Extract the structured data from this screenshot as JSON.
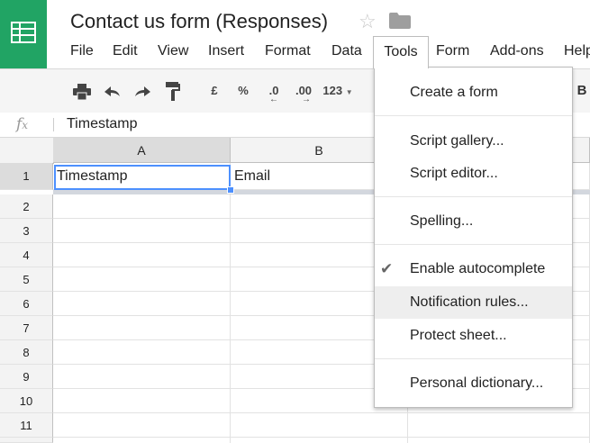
{
  "app": {
    "logo_icon": "sheets-logo-icon",
    "title": "Contact us form (Responses)"
  },
  "menubar": {
    "items": [
      "File",
      "Edit",
      "View",
      "Insert",
      "Format",
      "Data",
      "Tools",
      "Form",
      "Add-ons",
      "Help"
    ],
    "open_menu": "Tools"
  },
  "toolbar": {
    "currency": "£",
    "percent": "%",
    "decrease_decimals": ".0",
    "increase_decimals": ".00",
    "number_format": "123",
    "bold": "B"
  },
  "formula_bar": {
    "fx": "fx",
    "value": "Timestamp"
  },
  "grid": {
    "columns": [
      "A",
      "B"
    ],
    "rows": [
      "1",
      "2",
      "3",
      "4",
      "5",
      "6",
      "7",
      "8",
      "9",
      "10",
      "11"
    ],
    "cells": {
      "A1": "Timestamp",
      "B1": "Email"
    },
    "selected_cell": "A1"
  },
  "tools_menu": {
    "items": [
      "Create a form",
      "Script gallery...",
      "Script editor...",
      "Spelling...",
      "Enable autocomplete",
      "Notification rules...",
      "Protect sheet...",
      "Personal dictionary..."
    ],
    "checked": "Enable autocomplete",
    "highlighted": "Notification rules..."
  },
  "colors": {
    "brand": "#21a464",
    "selection": "#4d90fe"
  }
}
